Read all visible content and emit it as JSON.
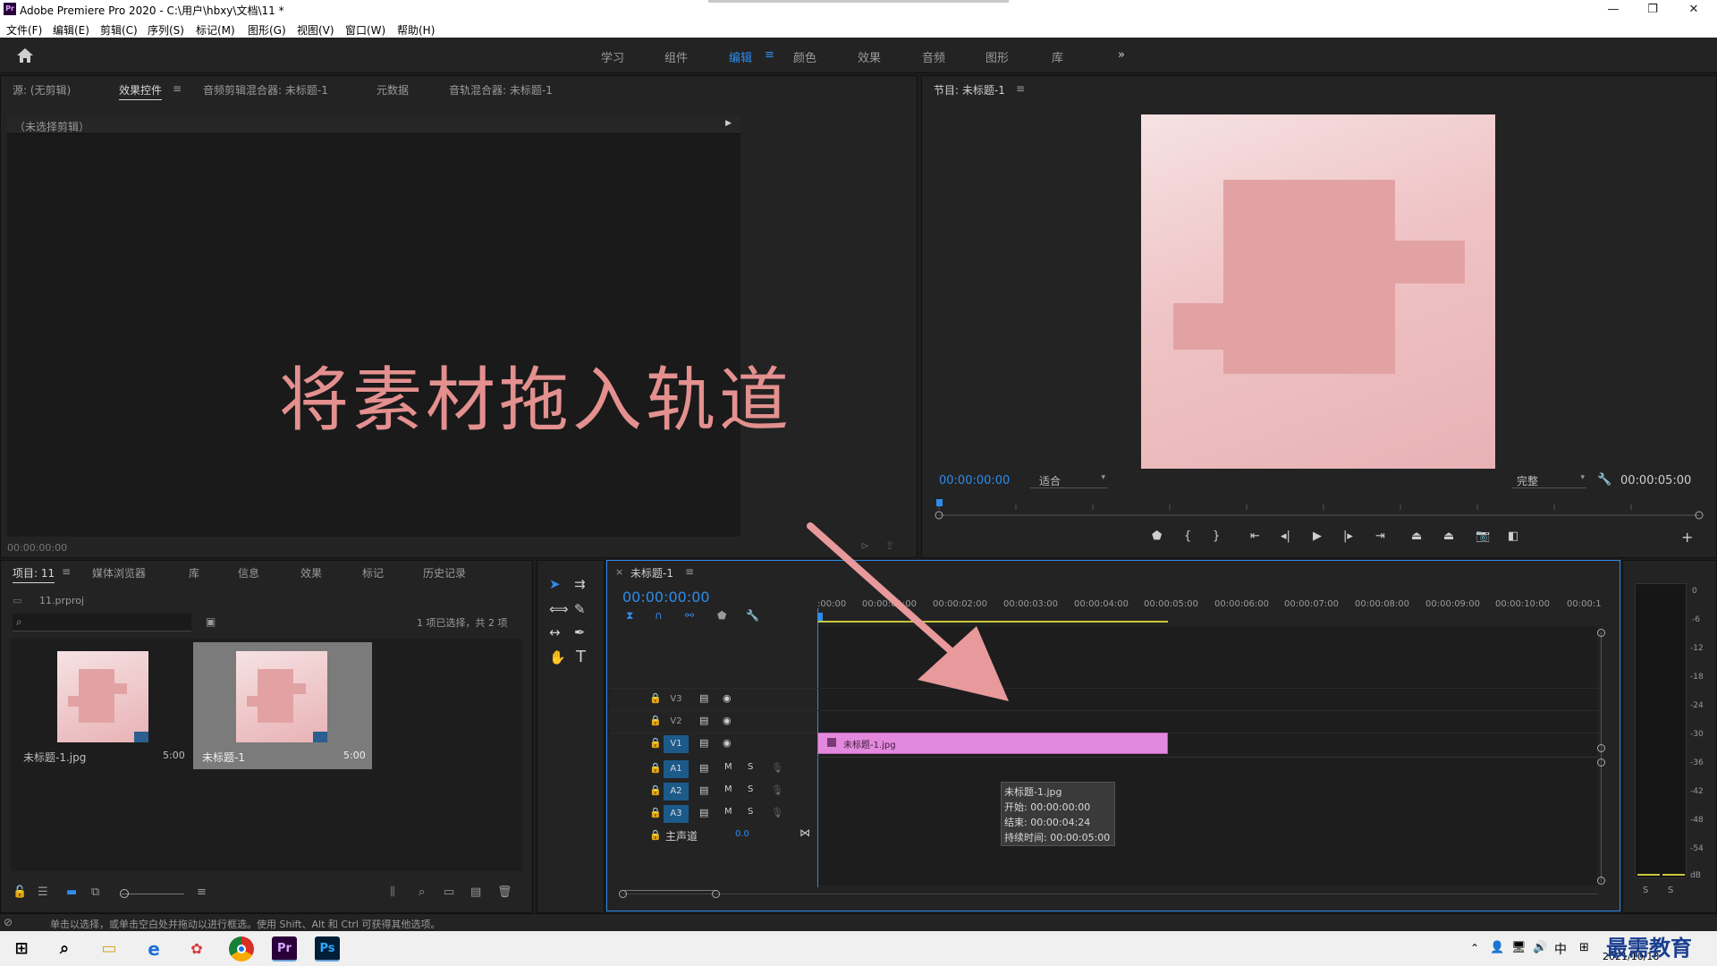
{
  "titlebar": {
    "app_title": "Adobe Premiere Pro 2020 - C:\\用户\\hbxy\\文档\\11 *",
    "logo": "Pr",
    "minimize": "—",
    "restore": "❐",
    "close": "✕"
  },
  "menu": [
    "文件(F)",
    "编辑(E)",
    "剪辑(C)",
    "序列(S)",
    "标记(M)",
    "图形(G)",
    "视图(V)",
    "窗口(W)",
    "帮助(H)"
  ],
  "workspaces": {
    "items": [
      "学习",
      "组件",
      "编辑",
      "颜色",
      "效果",
      "音频",
      "图形",
      "库"
    ],
    "active": "编辑",
    "overflow": "»"
  },
  "source_panel": {
    "tabs": [
      "源: (无剪辑)",
      "效果控件",
      "音频剪辑混合器: 未标题-1",
      "元数据",
      "音轨混合器: 未标题-1"
    ],
    "active_tab": "效果控件",
    "menu_glyph": "≡",
    "no_clip": "（未选择剪辑）",
    "timecode": "00:00:00:00",
    "overlay_caption": "将素材拖入轨道"
  },
  "program_panel": {
    "title": "节目: 未标题-1",
    "menu_glyph": "≡",
    "timecode": "00:00:00:00",
    "fit": "适合",
    "quality": "完整",
    "duration": "00:00:05:00"
  },
  "project_panel": {
    "tabs": [
      "项目: 11",
      "媒体浏览器",
      "库",
      "信息",
      "效果",
      "标记",
      "历史记录"
    ],
    "active_tab": "项目: 11",
    "menu_glyph": "≡",
    "file": "11.prproj",
    "selection": "1 项已选择，共 2 项",
    "items": [
      {
        "name": "未标题-1.jpg",
        "duration": "5:00"
      },
      {
        "name": "未标题-1",
        "duration": "5:00"
      }
    ]
  },
  "timeline": {
    "tab": "未标题-1",
    "menu_glyph": "≡",
    "close_glyph": "×",
    "timecode": "00:00:00:00",
    "ruler": [
      ":00:00",
      "00:00:01:00",
      "00:00:02:00",
      "00:00:03:00",
      "00:00:04:00",
      "00:00:05:00",
      "00:00:06:00",
      "00:00:07:00",
      "00:00:08:00",
      "00:00:09:00",
      "00:00:10:00",
      "00:00:1"
    ],
    "video_tracks": [
      "V3",
      "V2",
      "V1"
    ],
    "audio_tracks": [
      "A1",
      "A2",
      "A3"
    ],
    "mute_label": "M",
    "solo_label": "S",
    "master_label": "主声道",
    "master_value": "0.0",
    "clip_name": "未标题-1.jpg",
    "tooltip": {
      "name": "未标题-1.jpg",
      "start": "开始: 00:00:00:00",
      "end": "结束: 00:00:04:24",
      "duration": "持续时间: 00:00:05:00"
    }
  },
  "meters": {
    "scale": [
      "0",
      "-6",
      "-12",
      "-18",
      "-24",
      "-30",
      "-36",
      "-42",
      "-48",
      "-54",
      "dB"
    ],
    "solo": [
      "S",
      "S"
    ]
  },
  "statusbar": {
    "hint": "单击以选择，或单击空白处并拖动以进行框选。使用 Shift、Alt 和 Ctrl 可获得其他选项。"
  },
  "taskbar": {
    "apps": [
      "Pr",
      "Ps"
    ],
    "tray": {
      "ime": "中",
      "date": "2021/10/18"
    },
    "watermark": "最需教育"
  }
}
